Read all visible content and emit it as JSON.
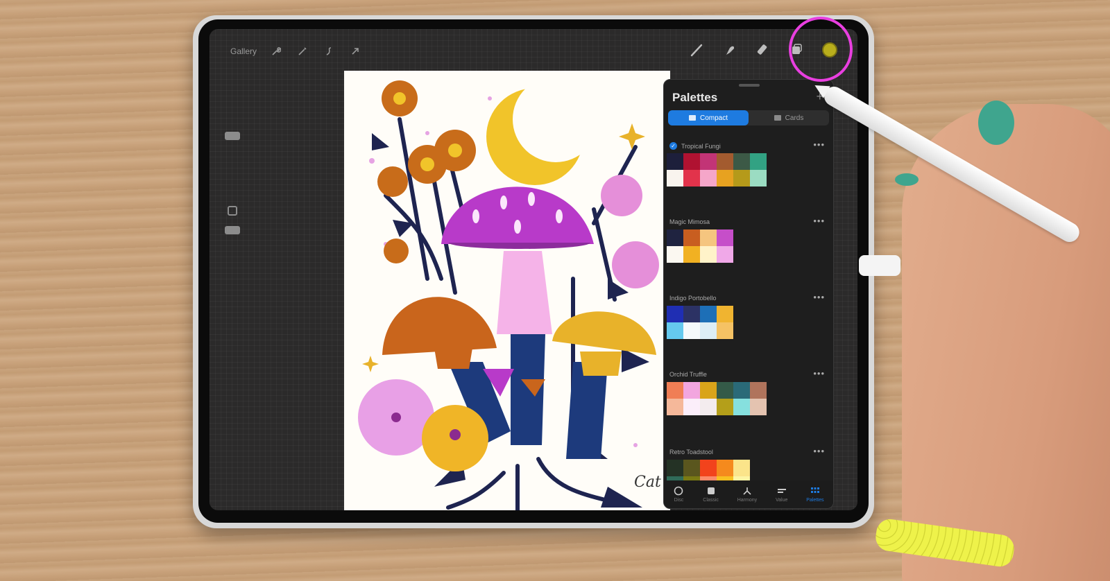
{
  "toolbar": {
    "gallery_label": "Gallery",
    "left_icons": [
      "wrench-icon",
      "magic-wand-icon",
      "selection-icon",
      "transform-arrow-icon"
    ],
    "right_icons": [
      "brush-icon",
      "smudge-icon",
      "eraser-icon",
      "layers-icon",
      "color-icon"
    ],
    "current_color": "#b9ae1c"
  },
  "palettes_panel": {
    "title": "Palettes",
    "add_label": "+",
    "view_modes": [
      "Compact",
      "Cards"
    ],
    "active_view": "Compact",
    "more_label": "•••",
    "items": [
      {
        "name": "Tropical Fungi",
        "default": true,
        "rows": [
          [
            "#1d1f3b",
            "#b01231",
            "#c23476",
            "#a35b2f",
            "#3c5946",
            "#32a283"
          ],
          [
            "#f9f4ee",
            "#e2334b",
            "#f5a6c9",
            "#e7a220",
            "#b59a1a",
            "#9bdcc2"
          ]
        ]
      },
      {
        "name": "Magic Mimosa",
        "rows": [
          [
            "#1f2340",
            "#c85e20",
            "#f5c57f",
            "#c64ec9"
          ],
          [
            "#fbf8f1",
            "#f1b122",
            "#fff3c9",
            "#f0a8e8"
          ]
        ]
      },
      {
        "name": "Indigo Portobello",
        "rows": [
          [
            "#1f2eb3",
            "#2c3264",
            "#1d6fb7",
            "#f0b430"
          ],
          [
            "#65c9ee",
            "#f5f9fb",
            "#ddeef6",
            "#f5c264"
          ]
        ]
      },
      {
        "name": "Orchid Truffle",
        "rows": [
          [
            "#f07e55",
            "#f2a6df",
            "#d9a41a",
            "#345a48",
            "#2a6a78",
            "#b0745c"
          ],
          [
            "#f5b89a",
            "#fbeefa",
            "#f3ecee",
            "#b49f1a",
            "#86e0de",
            "#e4c3b0"
          ]
        ]
      },
      {
        "name": "Retro Toadstool",
        "rows": [
          [
            "#243225",
            "#5a561e",
            "#f2431c",
            "#f58a1d",
            "#fbe48a"
          ],
          [
            "#306b59",
            "#7a7a13",
            "#fb8a6a",
            "#f8c021",
            "#fdf4a4"
          ]
        ]
      }
    ],
    "tabs": [
      {
        "label": "Disc",
        "icon": "disc-icon"
      },
      {
        "label": "Classic",
        "icon": "classic-icon"
      },
      {
        "label": "Harmony",
        "icon": "harmony-icon"
      },
      {
        "label": "Value",
        "icon": "value-icon"
      },
      {
        "label": "Palettes",
        "icon": "palettes-icon",
        "active": true
      }
    ]
  },
  "canvas": {
    "signature": "Cat"
  },
  "colors": {
    "accent": "#1e7be0",
    "highlight": "#e93fe0"
  }
}
